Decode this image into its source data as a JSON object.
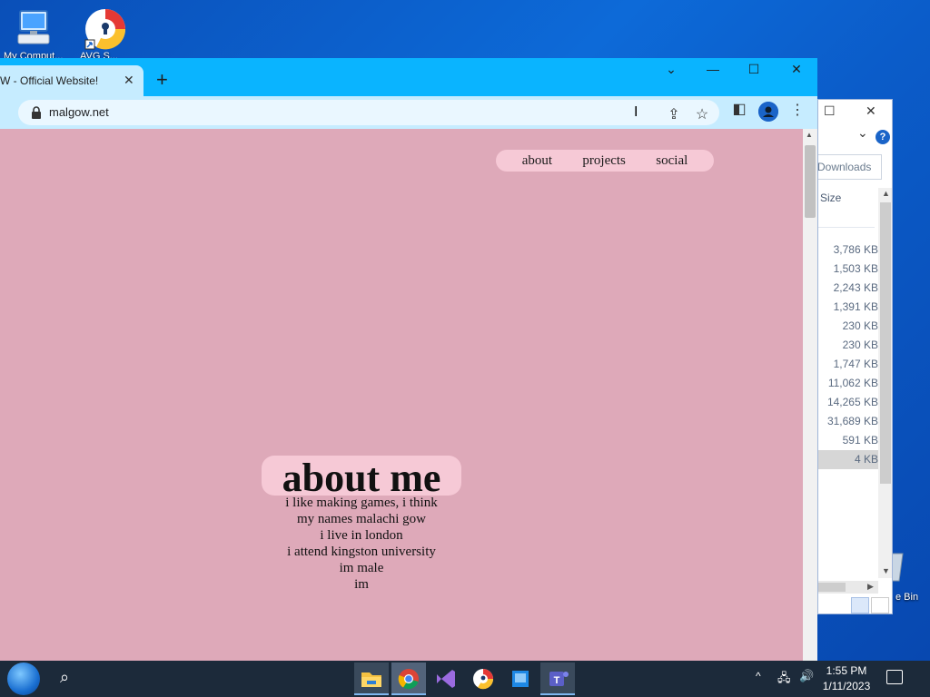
{
  "desktop": {
    "icon1_label": "My Comput...",
    "icon2_label": "AVG S...",
    "recycle_label": "e Bin"
  },
  "explorer": {
    "restore": "☐",
    "close": "✕",
    "chevron": "⌄",
    "help": "?",
    "downloads_label": "Downloads",
    "size_header": "Size",
    "sizes": [
      "3,786 KB",
      "1,503 KB",
      "2,243 KB",
      "1,391 KB",
      "230 KB",
      "230 KB",
      "1,747 KB",
      "11,062 KB",
      "14,265 KB",
      "31,689 KB",
      "591 KB",
      "4 KB"
    ]
  },
  "browser": {
    "tab_title": "W - Official Website!",
    "tab_close": "✕",
    "new_tab": "+",
    "url": "malgow.net",
    "window": {
      "dropdown": "⌄",
      "minimize": "—",
      "maximize": "☐",
      "close": "✕"
    }
  },
  "page": {
    "nav": [
      "about",
      "projects",
      "social"
    ],
    "about_title": "about me",
    "about_lines": [
      "i like making games, i think",
      "my names malachi gow",
      "i live in london",
      "i attend kingston university",
      "im male",
      "im"
    ]
  },
  "taskbar": {
    "time": "1:55 PM",
    "date": "1/11/2023"
  },
  "colors": {
    "page_bg": "#dea9b9",
    "nav_pill": "#f6c9d6",
    "chrome_title": "#0ab4ff",
    "chrome_toolbar": "#c6ecff"
  }
}
